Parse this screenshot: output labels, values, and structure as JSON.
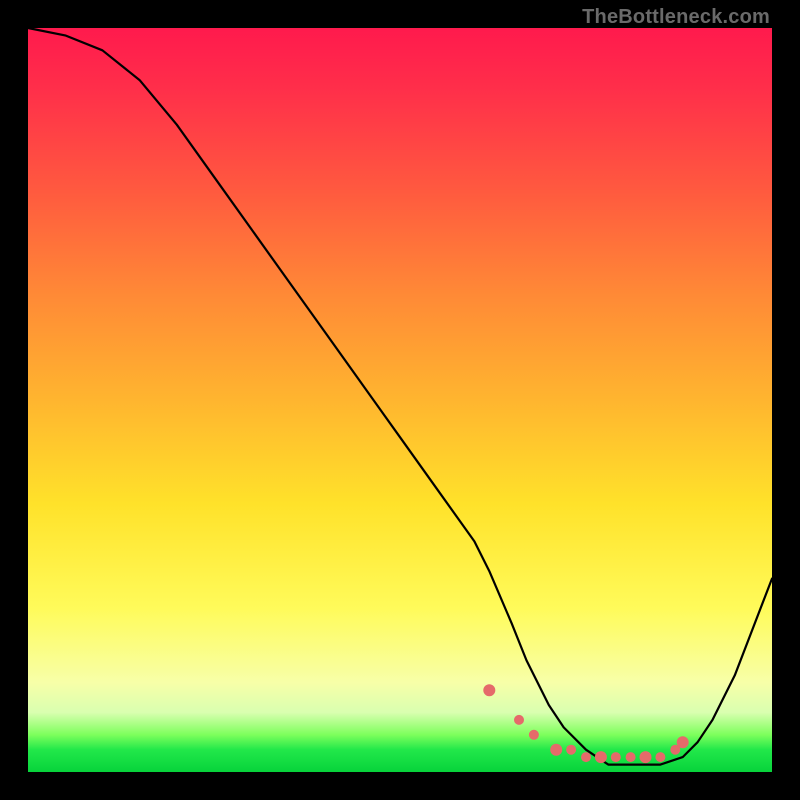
{
  "watermark": "TheBottleneck.com",
  "chart_data": {
    "type": "line",
    "title": "",
    "xlabel": "",
    "ylabel": "",
    "xlim": [
      0,
      100
    ],
    "ylim": [
      0,
      100
    ],
    "grid": false,
    "legend": false,
    "series": [
      {
        "name": "bottleneck-curve",
        "x": [
          0,
          5,
          10,
          15,
          20,
          25,
          30,
          35,
          40,
          45,
          50,
          55,
          60,
          62,
          65,
          67,
          70,
          72,
          75,
          78,
          80,
          82,
          85,
          88,
          90,
          92,
          95,
          100
        ],
        "values": [
          100,
          99,
          97,
          93,
          87,
          80,
          73,
          66,
          59,
          52,
          45,
          38,
          31,
          27,
          20,
          15,
          9,
          6,
          3,
          1,
          1,
          1,
          1,
          2,
          4,
          7,
          13,
          26
        ]
      }
    ],
    "markers": {
      "name": "optimal-range-markers",
      "x": [
        62,
        66,
        68,
        71,
        73,
        75,
        77,
        79,
        81,
        83,
        85,
        87,
        88
      ],
      "values": [
        11,
        7,
        5,
        3,
        3,
        2,
        2,
        2,
        2,
        2,
        2,
        3,
        4
      ]
    },
    "background_gradient": {
      "orientation": "vertical",
      "stops": [
        {
          "pos": 0.0,
          "color": "#ff1a4d"
        },
        {
          "pos": 0.36,
          "color": "#ff8a36"
        },
        {
          "pos": 0.64,
          "color": "#ffe22a"
        },
        {
          "pos": 0.88,
          "color": "#f7ffa8"
        },
        {
          "pos": 1.0,
          "color": "#07d33b"
        }
      ]
    }
  }
}
